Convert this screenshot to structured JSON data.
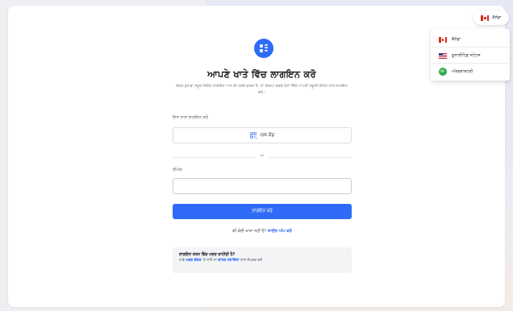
{
  "app": {
    "title": "ਆਪਣੇ ਖਾਤੇ ਵਿੱਚ ਲਾਗਇਨ ਕਰੋ",
    "subtitle": "ਜੇਕਰ ਤੁਹਾਡਾ ਸਕੂਲ ਇਕੱਲ ਲਾਗਇਨ ਆਨ ਕੀ ਹਰਤੋ ਕਰਦਾ ਹੈ, ਤਾਂ ਕਿਰਪਾ ਕਰਕੇ ਹੇਠਾਂ ਦਿੱਤੇ ਆਪਣੀ ਸਕੂਲੀ ਈਮੇਲ ਨਾਲ ਲਾਗਇਨ ਕਰੋ।"
  },
  "login_with": {
    "label": "ਇਸ ਨਾਲ ਲਾਗਇਨ ਕਰੋ",
    "qr_label": "QR ਕੋਡ"
  },
  "divider": {
    "label": "ਜਾਂ"
  },
  "email": {
    "label": "ਈਮੇਲ",
    "value": "",
    "placeholder": ""
  },
  "login_button": {
    "label": "ਲਾਗਇਨ ਕਰੋ"
  },
  "signup": {
    "prompt": "ਕੀ ਕੋਈ ਖਾਤਾ ਨਹੀਂ ਹੈ?",
    "link": "ਸਾਈਨ ਅੱਪ ਕਰੋ"
  },
  "help": {
    "title": "ਲਾਗਇਨ ਕਰਨ ਵਿੱਚ ਮਦਦ ਚਾਹੀਦੀ ਹੈ?",
    "text_before": "ਸਾਡੇ",
    "help_center_link": "ਮਦਦ ਕੇਂਦਰ",
    "text_middle": "'ਤੇ ਜਾਓ ਜਾਂ",
    "support_link": "ਗਾਹਕ ਸਹਾਇਤਾ",
    "text_after": "ਨਾਲ ਸੰਪਰਕ ਕਰੋ"
  },
  "language": {
    "selected": "ਕੈਨੇਡਾ",
    "options": [
      {
        "label": "ਕੈਨੇਡਾ",
        "icon": "canada-flag-icon"
      },
      {
        "label": "ਯੂਨਾਈਟਿਡ ਸਟੇਟਸ",
        "icon": "us-flag-icon"
      },
      {
        "label": "ਅੰਤਰਰਾਸ਼ਟਰੀ",
        "icon": "globe-icon"
      }
    ]
  },
  "colors": {
    "accent": "#2f6bf6",
    "canada_red": "#d52b1e",
    "globe_green": "#2fa84f"
  }
}
